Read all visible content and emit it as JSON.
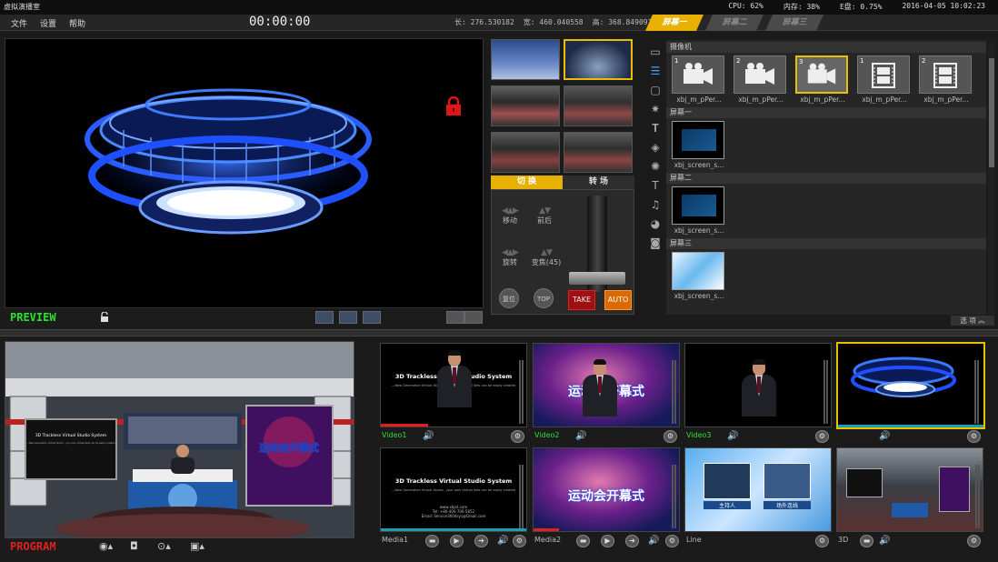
{
  "app": {
    "title": "虚拟演播室"
  },
  "status": {
    "cpu": "CPU: 62%",
    "memory": "内存: 38%",
    "disk": "E盘: 0.75%",
    "datetime": "2016-04-05 10:02:23"
  },
  "menu": [
    "文件",
    "设置",
    "帮助"
  ],
  "timecode": "00:00:00",
  "coords": {
    "length": "长: 276.530182",
    "width": "宽: 460.040558",
    "height": "高: 368.849091"
  },
  "screen_tabs": [
    "屏幕一",
    "屏幕二",
    "屏幕三"
  ],
  "preview": {
    "label": "PREVIEW"
  },
  "program": {
    "label": "PROGRAM"
  },
  "switch": {
    "tabs": [
      "切 换",
      "转 场"
    ],
    "move": "移动",
    "front_back": "前后",
    "rotate": "旋转",
    "zoom": "变焦(45)",
    "reset": "复位",
    "top": "TOP",
    "take": "TAKE",
    "auto": "AUTO"
  },
  "resources": {
    "camera_header": "摄像机",
    "cameras": [
      {
        "num": "1",
        "label": "xbj_m_pPer..."
      },
      {
        "num": "2",
        "label": "xbj_m_pPer..."
      },
      {
        "num": "3",
        "label": "xbj_m_pPer..."
      },
      {
        "num": "1",
        "label": "xbj_m_pPer..."
      },
      {
        "num": "2",
        "label": "xbj_m_pPer..."
      }
    ],
    "screen1_header": "屏幕一",
    "screen1_item": "xbj_screen_s...",
    "screen2_header": "屏幕二",
    "screen2_item": "xbj_screen_s...",
    "screen3_header": "屏幕三",
    "screen3_item": "xbj_screen_s...",
    "options": "选 项"
  },
  "tiles": [
    {
      "name": "Video1",
      "text1": "3D Trackless Virtual Studio System",
      "text2": "—New Generation Virtual Studio , your own Virtual Sets can be easily created"
    },
    {
      "name": "Video2",
      "text1": "运动会开幕式"
    },
    {
      "name": "Video3"
    },
    {
      "name": ""
    },
    {
      "name": "Media1",
      "text1": "3D Trackless Virtual Studio System",
      "text2": "—New Generation Virtual Studio , your own Virtual Sets can be easily created",
      "text3": "www.xbjxt.com",
      "text4": "Tel: +86-400-700-5652",
      "text5": "Email: Service360dsys@Gmail.com"
    },
    {
      "name": "Media2",
      "text1": "运动会开幕式"
    },
    {
      "name": "Line",
      "text1": "主持人",
      "text2": "场外连线"
    },
    {
      "name": "3D"
    }
  ],
  "program_scene": {
    "screen_title": "3D Trackless Virtual Studio System",
    "screen_sub": "—New Generation Virtual Studio , your own Virtual Sets can be easily created",
    "right_screen_text": "运动会开幕式"
  }
}
